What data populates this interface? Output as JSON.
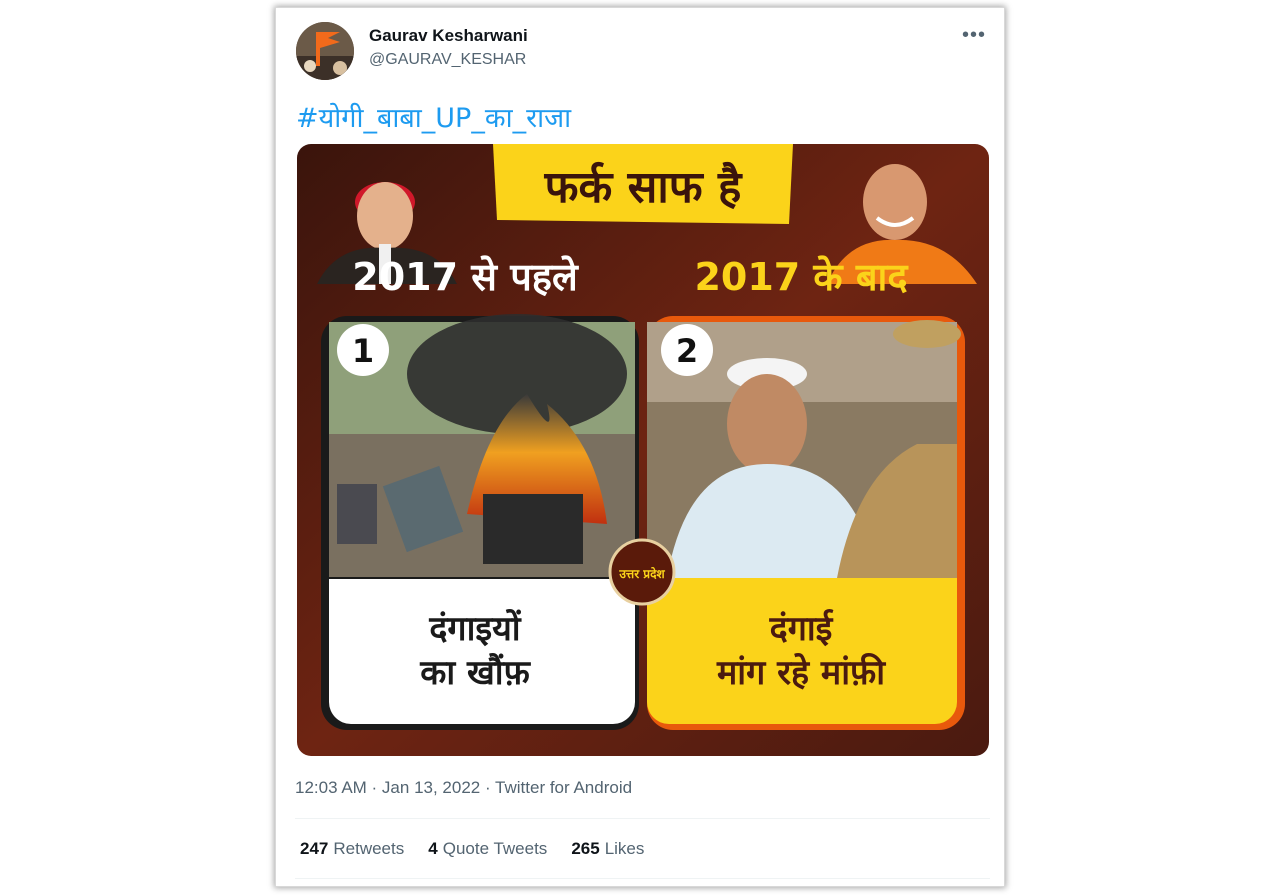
{
  "tweet": {
    "author_name": "Gaurav Kesharwani",
    "author_handle": "@GAURAV_KESHAR",
    "more_icon": "more-icon",
    "text": "#योगी_बाबा_UP_का_राजा",
    "timestamp": "12:03 AM · Jan 13, 2022 · Twitter for Android"
  },
  "stats": {
    "retweets_count": "247",
    "retweets_label": "Retweets",
    "quotes_count": "4",
    "quotes_label": "Quote Tweets",
    "likes_count": "265",
    "likes_label": "Likes"
  },
  "graphic": {
    "headline": "फर्क साफ है",
    "left_heading": "2017 से पहले",
    "right_heading": "2017 के बाद",
    "left_number": "1",
    "right_number": "2",
    "left_caption_line1": "दंगाइयों",
    "left_caption_line2": "का खौंफ़",
    "right_caption_line1": "दंगाई",
    "right_caption_line2": "मांग रहे मांफ़ी",
    "seal_text": "उत्तर प्रदेश",
    "colors": {
      "background_dark": "#4a1a10",
      "background_mid": "#7a2a14",
      "yellow": "#fbd31a",
      "orange_border": "#e8590c"
    }
  }
}
